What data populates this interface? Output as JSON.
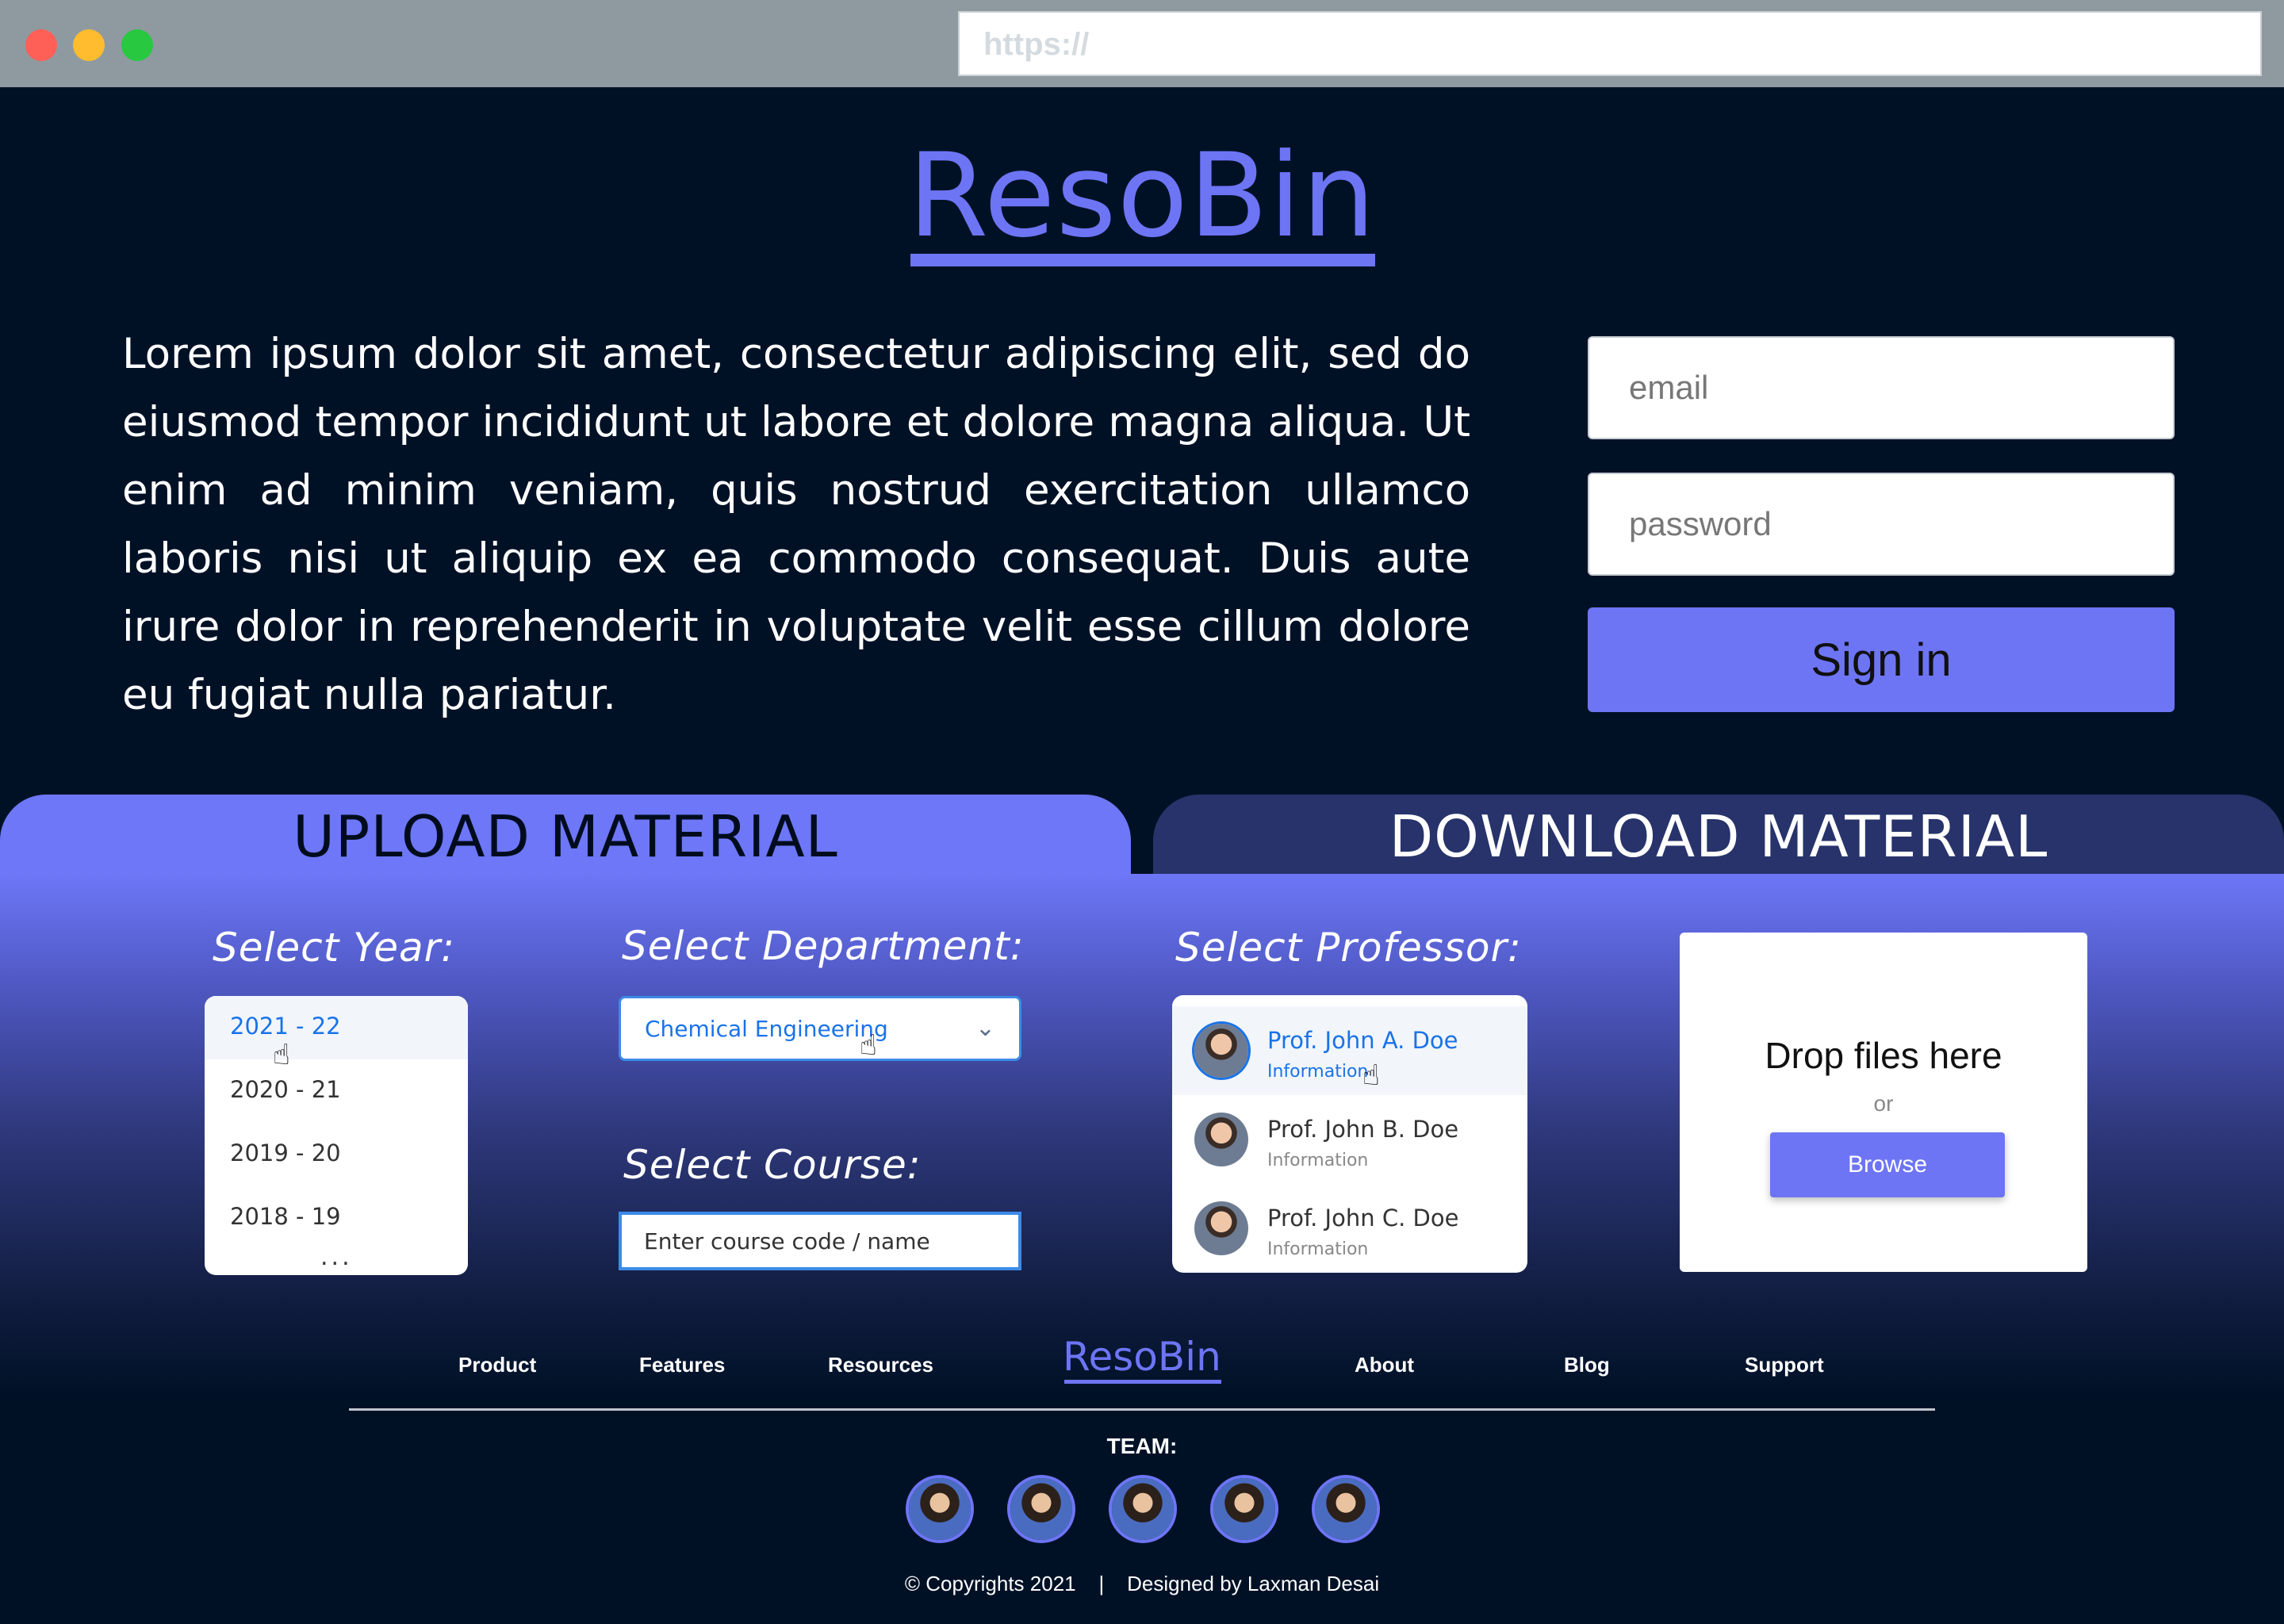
{
  "browser": {
    "url": "https://"
  },
  "hero": {
    "logo": "ResoBin",
    "description": "Lorem ipsum dolor sit amet, consectetur adipiscing elit, sed do eiusmod tempor incididunt ut labore et dolore magna aliqua. Ut enim ad minim veniam, quis nostrud exercitation ullamco laboris nisi ut aliquip ex ea commodo consequat. Duis aute irure dolor in reprehenderit in voluptate velit esse cillum dolore eu fugiat nulla pariatur."
  },
  "login": {
    "email_placeholder": "email",
    "password_placeholder": "password",
    "signin_label": "Sign in"
  },
  "tabs": {
    "upload": "UPLOAD MATERIAL",
    "download": "DOWNLOAD MATERIAL"
  },
  "upload": {
    "year_label": "Select  Year:",
    "years": [
      "2021 - 22",
      "2020 - 21",
      "2019 - 20",
      "2018 - 19"
    ],
    "year_more": "...",
    "department_label": "Select  Department:",
    "department_value": "Chemical Engineering",
    "course_label": "Select  Course:",
    "course_placeholder": "Enter course code / name",
    "professor_label": "Select  Professor:",
    "professors": [
      {
        "name": "Prof. John A. Doe",
        "info": "Information"
      },
      {
        "name": "Prof. John B. Doe",
        "info": "Information"
      },
      {
        "name": "Prof. John C. Doe",
        "info": "Information"
      }
    ],
    "drop_title": "Drop files here",
    "drop_or": "or",
    "browse_label": "Browse"
  },
  "footer": {
    "nav": [
      "Product",
      "Features",
      "Resources",
      "About",
      "Blog",
      "Support"
    ],
    "logo": "ResoBin",
    "team_label": "TEAM:",
    "copyright": "© Copyrights 2021    |    Designed by Laxman Desai"
  },
  "colors": {
    "accent": "#6d75f5",
    "background": "#001126",
    "link": "#1a73e8"
  }
}
